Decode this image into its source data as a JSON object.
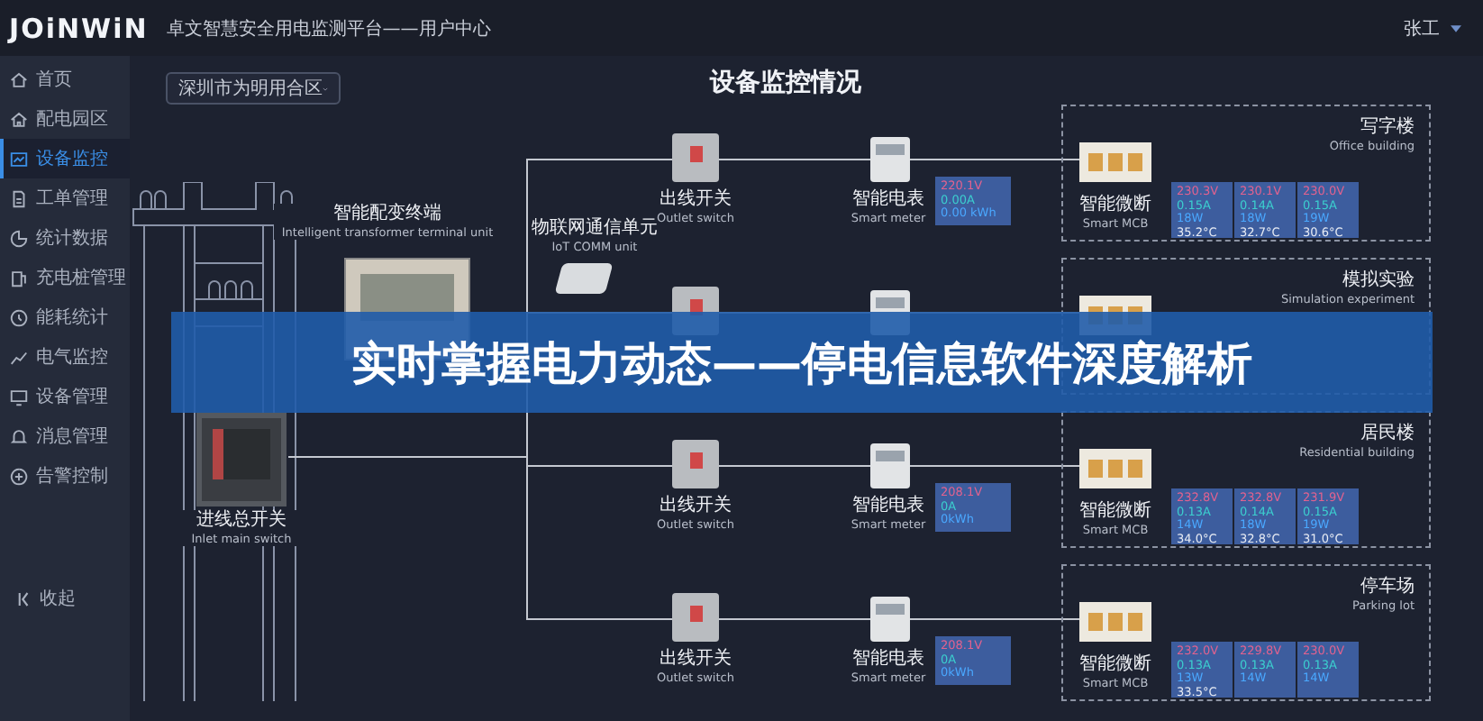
{
  "header": {
    "logo": "JOiNWiN",
    "title": "卓文智慧安全用电监测平台——用户中心",
    "user": "张工"
  },
  "sidebar": {
    "items": [
      {
        "label": "首页",
        "selected": false
      },
      {
        "label": "配电园区",
        "selected": false
      },
      {
        "label": "设备监控",
        "selected": true
      },
      {
        "label": "工单管理",
        "selected": false
      },
      {
        "label": "统计数据",
        "selected": false
      },
      {
        "label": "充电桩管理",
        "selected": false
      },
      {
        "label": "能耗统计",
        "selected": false
      },
      {
        "label": "电气监控",
        "selected": false
      },
      {
        "label": "设备管理",
        "selected": false
      },
      {
        "label": "消息管理",
        "selected": false
      },
      {
        "label": "告警控制",
        "selected": false
      }
    ],
    "collapse": "收起"
  },
  "site_select": {
    "value": "深圳市为明用合区"
  },
  "title": "设备监控情况",
  "terminal": {
    "name": "智能配变终端",
    "name_en": "Intelligent transformer terminal unit"
  },
  "iot": {
    "name": "物联网通信单元",
    "name_en": "IoT COMM unit"
  },
  "inlet": {
    "name": "进线总开关",
    "name_en": "Inlet main switch"
  },
  "rows": [
    {
      "outlet": {
        "name": "出线开关",
        "name_en": "Outlet switch"
      },
      "meter": {
        "name": "智能电表",
        "name_en": "Smart meter",
        "readings": [
          "220.1V",
          "0.00A",
          "0.00 kWh"
        ]
      },
      "group": {
        "title": "写字楼",
        "subtitle": "Office building",
        "mcb": {
          "name": "智能微断",
          "name_en": "Smart MCB"
        },
        "panels": [
          {
            "lines": [
              "230.3V",
              "0.15A",
              "18W",
              "35.2°C"
            ]
          },
          {
            "lines": [
              "230.1V",
              "0.14A",
              "18W",
              "32.7°C"
            ]
          },
          {
            "lines": [
              "230.0V",
              "0.15A",
              "19W",
              "30.6°C"
            ]
          }
        ]
      }
    },
    {
      "outlet": {},
      "meter": {},
      "group": {
        "title": "模拟实验",
        "subtitle": "Simulation experiment"
      }
    },
    {
      "outlet": {
        "name": "出线开关",
        "name_en": "Outlet switch"
      },
      "meter": {
        "name": "智能电表",
        "name_en": "Smart meter",
        "readings": [
          "208.1V",
          "0A",
          "0kWh"
        ]
      },
      "group": {
        "title": "居民楼",
        "subtitle": "Residential building",
        "mcb": {
          "name": "智能微断",
          "name_en": "Smart MCB"
        },
        "panels": [
          {
            "lines": [
              "232.8V",
              "0.13A",
              "14W",
              "34.0°C"
            ]
          },
          {
            "lines": [
              "232.8V",
              "0.14A",
              "18W",
              "32.8°C"
            ]
          },
          {
            "lines": [
              "231.9V",
              "0.15A",
              "19W",
              "31.0°C"
            ]
          }
        ]
      }
    },
    {
      "outlet": {
        "name": "出线开关",
        "name_en": "Outlet switch"
      },
      "meter": {
        "name": "智能电表",
        "name_en": "Smart meter",
        "readings": [
          "208.1V",
          "0A",
          "0kWh"
        ]
      },
      "group": {
        "title": "停车场",
        "subtitle": "Parking lot",
        "mcb": {
          "name": "智能微断",
          "name_en": "Smart MCB"
        },
        "panels": [
          {
            "lines": [
              "232.0V",
              "0.13A",
              "13W",
              "33.5°C"
            ]
          },
          {
            "lines": [
              "229.8V",
              "0.13A",
              "14W"
            ]
          },
          {
            "lines": [
              "230.0V",
              "0.13A",
              "14W"
            ]
          }
        ]
      }
    }
  ],
  "banner": {
    "text": "实时掌握电力动态——停电信息软件深度解析"
  }
}
